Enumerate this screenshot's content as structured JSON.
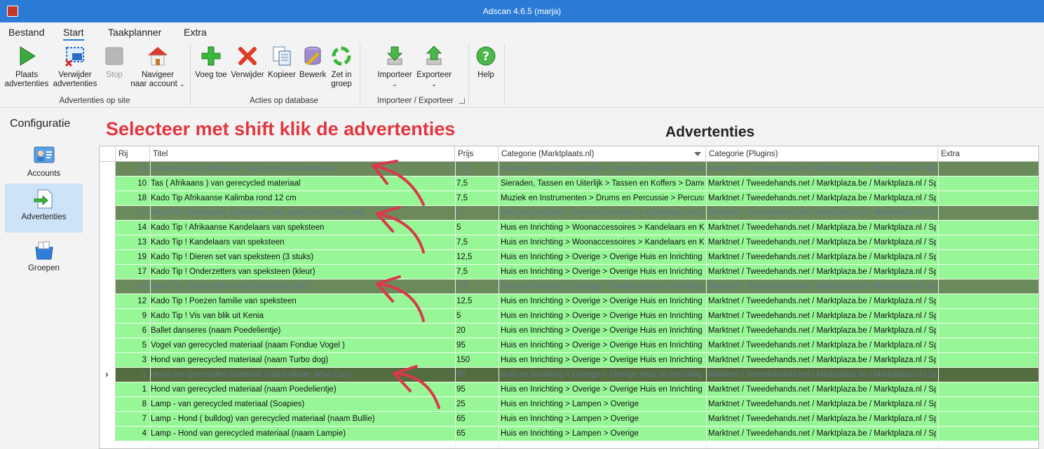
{
  "window": {
    "title": "Adscan 4.6.5 (marja)"
  },
  "tabs": [
    "Bestand",
    "Start",
    "Taakplanner",
    "Extra"
  ],
  "ribbon": {
    "buttons": [
      {
        "label1": "Plaats",
        "label2": "advertenties",
        "icon": "play-icon"
      },
      {
        "label1": "Verwijder",
        "label2": "advertenties",
        "icon": "remove-screen-icon"
      },
      {
        "label1": "Stop",
        "label2": "",
        "icon": "stop-icon"
      },
      {
        "label1": "Navigeer",
        "label2": "naar account",
        "icon": "home-icon"
      },
      {
        "label1": "Voeg toe",
        "label2": "",
        "icon": "add-icon"
      },
      {
        "label1": "Verwijder",
        "label2": "",
        "icon": "delete-icon"
      },
      {
        "label1": "Kopieer",
        "label2": "",
        "icon": "copy-icon"
      },
      {
        "label1": "Bewerk",
        "label2": "",
        "icon": "edit-database-icon"
      },
      {
        "label1": "Zet in",
        "label2": "groep",
        "icon": "group-cycle-icon"
      },
      {
        "label1": "Importeer",
        "label2": "",
        "icon": "import-icon"
      },
      {
        "label1": "Exporteer",
        "label2": "",
        "icon": "export-icon"
      },
      {
        "label1": "Help",
        "label2": "",
        "icon": "help-icon"
      }
    ],
    "groups": [
      "Advertenties op site",
      "Acties op database",
      "Importeer / Exporteer"
    ]
  },
  "leftnav": {
    "heading": "Configuratie",
    "items": [
      "Accounts",
      "Advertenties",
      "Groepen"
    ]
  },
  "annotation": "Selecteer met shift klik de advertenties",
  "grid": {
    "title": "Advertenties",
    "columns": [
      "Rij",
      "Titel",
      "Prijs",
      "Categorie (Marktplaats.nl)",
      "Categorie (Plugins)",
      "Extra"
    ],
    "rows": [
      {
        "rij": "11",
        "titel": "Kleurrijke  Tas ( Afrikaans ) van gerecycled materiaal",
        "prijs": "7,5",
        "cat": "Sieraden, Tassen en Uiterlijk > Tassen en Koffers > Dame...",
        "plug": "Marktnet / Tweedehands.net / Marktplaza.be / Marktplaza.nl / Sp...",
        "selected": true
      },
      {
        "rij": "10",
        "titel": "Tas ( Afrikaans ) van gerecycled materiaal",
        "prijs": "7,5",
        "cat": "Sieraden, Tassen en Uiterlijk > Tassen en Koffers > Dame...",
        "plug": "Marktnet / Tweedehands.net / Marktplaza.be / Marktplaza.nl / Sp...",
        "selected": false
      },
      {
        "rij": "18",
        "titel": "Kado Tip  Afrikaanse Kalimba rond 12 cm",
        "prijs": "7,5",
        "cat": "Muziek en Instrumenten > Drums en Percussie > Percussie",
        "plug": "Marktnet / Tweedehands.net / Marktplaza.be / Marktplaza.nl / Sp...",
        "selected": false
      },
      {
        "rij": "15",
        "titel": "Kado Tip ! Afrikaanse  Kandelaars van speksteen ( kleur wit)",
        "prijs": "5",
        "cat": "Huis en Inrichting > Woonaccessoires > Kandelaars en Ka...",
        "plug": "Marktnet / Tweedehands.net / Marktplaza.be / Marktplaza.nl / Sp...",
        "selected": true
      },
      {
        "rij": "14",
        "titel": "Kado Tip ! Afrikaanse  Kandelaars van speksteen",
        "prijs": "5",
        "cat": "Huis en Inrichting > Woonaccessoires > Kandelaars en Ka...",
        "plug": "Marktnet / Tweedehands.net / Marktplaza.be / Marktplaza.nl / Sp...",
        "selected": false
      },
      {
        "rij": "13",
        "titel": "Kado Tip ! Kandelaars van speksteen",
        "prijs": "7,5",
        "cat": "Huis en Inrichting > Woonaccessoires > Kandelaars en Ka...",
        "plug": "Marktnet / Tweedehands.net / Marktplaza.be / Marktplaza.nl / Sp...",
        "selected": false
      },
      {
        "rij": "19",
        "titel": "Kado Tip ! Dieren set van speksteen (3 stuks)",
        "prijs": "12,5",
        "cat": "Huis en Inrichting > Overige > Overige Huis en Inrichting",
        "plug": "Marktnet / Tweedehands.net / Marktplaza.be / Marktplaza.nl / Sp...",
        "selected": false
      },
      {
        "rij": "17",
        "titel": " Kado Tip ! Onderzetters van speksteen (kleur)",
        "prijs": "7,5",
        "cat": "Huis en Inrichting > Overige > Overige Huis en Inrichting",
        "plug": "Marktnet / Tweedehands.net / Marktplaza.be / Marktplaza.nl / Sp...",
        "selected": false
      },
      {
        "rij": "16",
        "titel": "Kado Tip ! Onderzetters van speksteen (wit)",
        "prijs": "7,5",
        "cat": "Huis en Inrichting > Overige > Overige Huis en Inrichting",
        "plug": "Marktnet / Tweedehands.net / Marktplaza.be / Marktplaza.nl / Sp...",
        "selected": true
      },
      {
        "rij": "12",
        "titel": "Kado Tip ! Poezen familie van speksteen",
        "prijs": "12,5",
        "cat": "Huis en Inrichting > Overige > Overige Huis en Inrichting",
        "plug": "Marktnet / Tweedehands.net / Marktplaza.be / Marktplaza.nl / Sp...",
        "selected": false
      },
      {
        "rij": "9",
        "titel": "Kado Tip !  Vis van blik uit Kenia",
        "prijs": "5",
        "cat": "Huis en Inrichting > Overige > Overige Huis en Inrichting",
        "plug": "Marktnet / Tweedehands.net / Marktplaza.be / Marktplaza.nl / Sp...",
        "selected": false
      },
      {
        "rij": "6",
        "titel": "Ballet danseres  (naam Poedelientje)",
        "prijs": "20",
        "cat": "Huis en Inrichting > Overige > Overige Huis en Inrichting",
        "plug": "Marktnet / Tweedehands.net / Marktplaza.be / Marktplaza.nl / Sp...",
        "selected": false
      },
      {
        "rij": "5",
        "titel": "Vogel van gerecycled materiaal  (naam Fondue Vogel )",
        "prijs": "95",
        "cat": "Huis en Inrichting > Overige > Overige Huis en Inrichting",
        "plug": "Marktnet / Tweedehands.net / Marktplaza.be / Marktplaza.nl / Sp...",
        "selected": false
      },
      {
        "rij": "3",
        "titel": "Hond van gerecycled materiaal  (naam Turbo dog)",
        "prijs": "150",
        "cat": "Huis en Inrichting > Overige > Overige Huis en Inrichting",
        "plug": "Marktnet / Tweedehands.net / Marktplaza.be / Marktplaza.nl / Sp...",
        "selected": false
      },
      {
        "rij": "2",
        "titel": "Hond van gerecycled materiaal  (naam Mister Wise Guy)",
        "prijs": "95",
        "cat": "Huis en Inrichting > Overige > Overige Huis en Inrichting",
        "plug": "Marktnet / Tweedehands.net / Marktplaza.be / Marktplaza.nl / Sp...",
        "selected": true,
        "current": true
      },
      {
        "rij": "1",
        "titel": "Hond van gerecycled materiaal  (naam Poedelientje)",
        "prijs": "95",
        "cat": "Huis en Inrichting > Overige > Overige Huis en Inrichting",
        "plug": "Marktnet / Tweedehands.net / Marktplaza.be / Marktplaza.nl / Sp...",
        "selected": false
      },
      {
        "rij": "8",
        "titel": "Lamp - van gerecycled materiaal  (Soapies)",
        "prijs": "25",
        "cat": "Huis en Inrichting > Lampen > Overige",
        "plug": "Marktnet / Tweedehands.net / Marktplaza.be / Marktplaza.nl / Sp...",
        "selected": false
      },
      {
        "rij": "7",
        "titel": " Lamp - Hond ( bulldog) van gerecycled materiaal  (naam Bullie)",
        "prijs": "65",
        "cat": "Huis en Inrichting > Lampen > Overige",
        "plug": "Marktnet / Tweedehands.net / Marktplaza.be / Marktplaza.nl / Sp...",
        "selected": false
      },
      {
        "rij": "4",
        "titel": "Lamp - Hond van gerecycled materiaal  (naam Lampie)",
        "prijs": "65",
        "cat": "Huis en Inrichting > Lampen > Overige",
        "plug": "Marktnet / Tweedehands.net / Marktplaza.be / Marktplaza.nl / Sp...",
        "selected": false
      }
    ]
  },
  "colors": {
    "titlebar": "#2b7bd6",
    "row": "#97f797",
    "row_selected": "#6b8a5c",
    "annotation": "#e2363f"
  }
}
